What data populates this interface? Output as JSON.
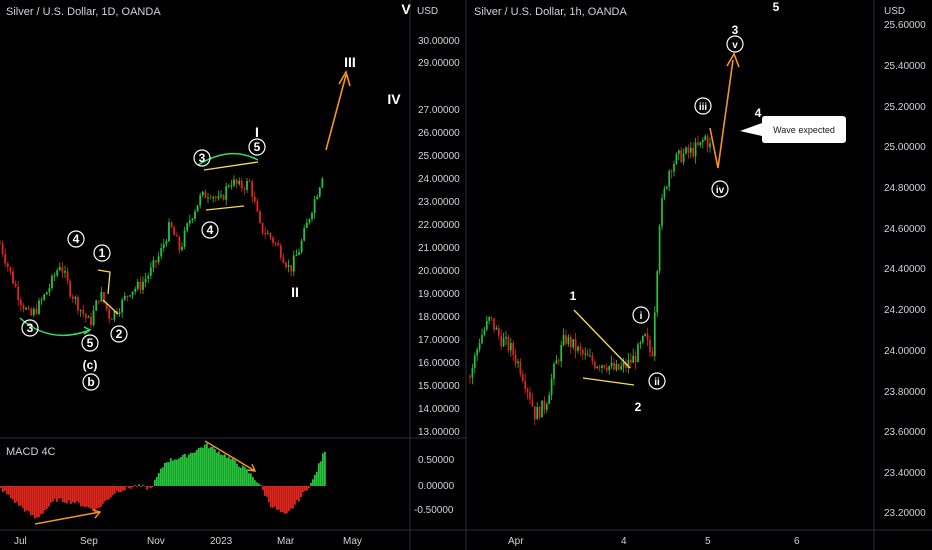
{
  "left_chart": {
    "title": "Silver / U.S. Dollar, 1D, OANDA",
    "currency": "USD",
    "y_ticks": [
      "30.00000",
      "29.00000",
      "27.00000",
      "26.00000",
      "25.00000",
      "24.00000",
      "23.00000",
      "22.00000",
      "21.00000",
      "20.00000",
      "19.00000",
      "18.00000",
      "17.00000",
      "16.00000",
      "15.00000",
      "14.00000",
      "13.00000"
    ],
    "macd_label": "MACD 4C",
    "macd_ticks": [
      "0.50000",
      "0.00000",
      "-0.50000"
    ],
    "x_ticks": [
      "Jul",
      "Sep",
      "Nov",
      "2023",
      "Mar",
      "May"
    ],
    "wave_labels": [
      "4",
      "1",
      "3",
      "2",
      "5",
      "(c)",
      "b",
      "3",
      "5",
      "4"
    ],
    "roman_labels": [
      "I",
      "II",
      "III",
      "IV",
      "V"
    ]
  },
  "right_chart": {
    "title": "Silver / U.S. Dollar, 1h, OANDA",
    "currency": "USD",
    "y_ticks": [
      "25.60000",
      "25.40000",
      "25.20000",
      "25.00000",
      "24.80000",
      "24.60000",
      "24.40000",
      "24.20000",
      "24.00000",
      "23.80000",
      "23.60000",
      "23.40000",
      "23.20000"
    ],
    "x_ticks": [
      "Apr",
      "4",
      "5",
      "6"
    ],
    "wave_labels": [
      "1",
      "2",
      "3",
      "4",
      "5"
    ],
    "sub_labels": [
      "i",
      "ii",
      "iii",
      "iv",
      "v"
    ],
    "callout": "Wave expected"
  },
  "colors": {
    "up": "#26c43a",
    "down": "#e0261d",
    "fib_yellow": "#f5e04f",
    "arrow_orange": "#f7931e",
    "arrow_green": "#2ee06a",
    "divider": "#2a2e39"
  },
  "chart_data": [
    {
      "type": "candlestick",
      "title": "Silver / U.S. Dollar, 1D, OANDA",
      "ylim": [
        13,
        31
      ],
      "x": [
        "Jul",
        "Sep",
        "Nov",
        "2023",
        "Mar",
        "May"
      ],
      "close_path": [
        [
          0,
          21.5
        ],
        [
          10,
          20.2
        ],
        [
          20,
          19.0
        ],
        [
          30,
          18.2
        ],
        [
          40,
          18.8
        ],
        [
          50,
          19.6
        ],
        [
          60,
          20.6
        ],
        [
          70,
          19.4
        ],
        [
          80,
          18.6
        ],
        [
          90,
          17.9
        ],
        [
          100,
          19.3
        ],
        [
          110,
          18.2
        ],
        [
          120,
          18.7
        ],
        [
          130,
          19.4
        ],
        [
          140,
          19.6
        ],
        [
          150,
          20.2
        ],
        [
          160,
          21.0
        ],
        [
          170,
          22.3
        ],
        [
          180,
          21.2
        ],
        [
          190,
          22.6
        ],
        [
          200,
          23.5
        ],
        [
          210,
          23.8
        ],
        [
          220,
          23.3
        ],
        [
          230,
          24.3
        ],
        [
          240,
          24.0
        ],
        [
          250,
          24.2
        ],
        [
          260,
          22.2
        ],
        [
          270,
          21.8
        ],
        [
          280,
          21.2
        ],
        [
          290,
          20.3
        ],
        [
          300,
          21.3
        ],
        [
          310,
          22.8
        ],
        [
          320,
          24.2
        ],
        [
          325,
          25.0
        ]
      ],
      "macd_ylim": [
        -0.8,
        0.8
      ]
    },
    {
      "type": "candlestick",
      "title": "Silver / U.S. Dollar, 1h, OANDA",
      "ylim": [
        23.1,
        25.7
      ],
      "x": [
        "Apr",
        "4",
        "5",
        "6"
      ],
      "close_path": [
        [
          470,
          23.85
        ],
        [
          480,
          24.05
        ],
        [
          490,
          24.15
        ],
        [
          500,
          24.05
        ],
        [
          510,
          24.0
        ],
        [
          520,
          23.9
        ],
        [
          530,
          23.75
        ],
        [
          535,
          23.65
        ],
        [
          545,
          23.7
        ],
        [
          555,
          23.9
        ],
        [
          565,
          24.05
        ],
        [
          575,
          24.0
        ],
        [
          585,
          23.95
        ],
        [
          595,
          23.92
        ],
        [
          605,
          23.92
        ],
        [
          615,
          23.88
        ],
        [
          625,
          23.9
        ],
        [
          635,
          23.95
        ],
        [
          645,
          24.05
        ],
        [
          652,
          23.95
        ],
        [
          660,
          24.7
        ],
        [
          670,
          24.95
        ],
        [
          680,
          25.0
        ],
        [
          690,
          25.02
        ],
        [
          700,
          25.05
        ],
        [
          705,
          25.1
        ],
        [
          710,
          25.05
        ]
      ]
    }
  ]
}
